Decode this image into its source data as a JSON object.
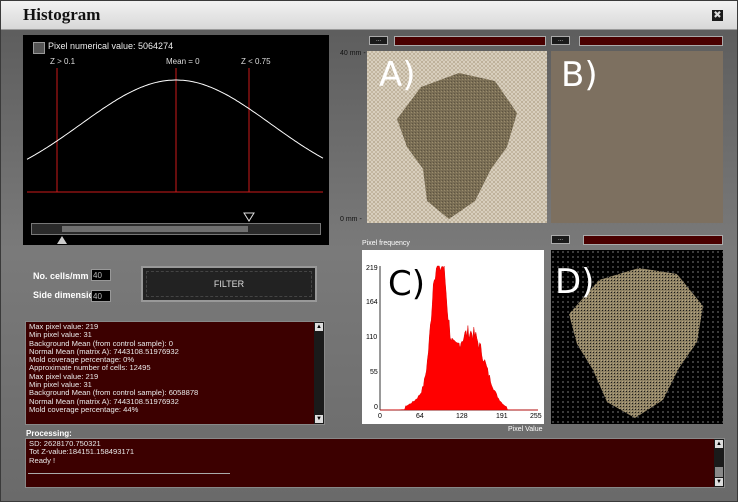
{
  "window": {
    "title": "Histogram",
    "close_glyph": "✖"
  },
  "distribution": {
    "pixel_numerical_label": "Pixel numerical value: 5064274",
    "z_left": "Z > 0.1",
    "mean": "Mean = 0",
    "z_right": "Z < 0.75",
    "slider_value_fraction": 0.7
  },
  "controls": {
    "cells_label": "No. cells/mm",
    "cells_value": "40",
    "side_label": "Side dimension",
    "side_value": "40",
    "filter_label": "FILTER"
  },
  "log": {
    "lines": [
      "Max pixel value: 219",
      "Min pixel value: 31",
      "Background Mean (from control sample): 0",
      "Normal Mean (matrix A): 7443108.51976932",
      "Mold coverage percentage: 0%",
      "Approximate number of cells: 12495",
      "Max pixel value: 219",
      "Min pixel value: 31",
      "Background Mean (from control sample): 6058878",
      "Normal Mean (matrix A): 7443108.51976932",
      "Mold coverage percentage: 44%"
    ]
  },
  "processing": {
    "label": "Processing:",
    "lines": [
      "SD: 2628170.750321",
      "Tot Z-value:184151.158493171",
      "Ready !"
    ]
  },
  "images": {
    "scale_top": "40  mm -",
    "scale_bottom": "0 mm -",
    "btn_label": "...",
    "a": "A)",
    "b": "B)",
    "c": "C)",
    "d": "D)"
  },
  "histogram": {
    "ylabel": "Pixel frequency",
    "xlabel": "Pixel Value",
    "yticks": [
      "219",
      "164",
      "110",
      "55",
      "0"
    ],
    "xticks": [
      "0",
      "64",
      "128",
      "191",
      "255"
    ]
  },
  "colors": {
    "log_bg": "#3c0000",
    "hist_fill": "#ff0000",
    "b_fill": "#7d7060"
  }
}
